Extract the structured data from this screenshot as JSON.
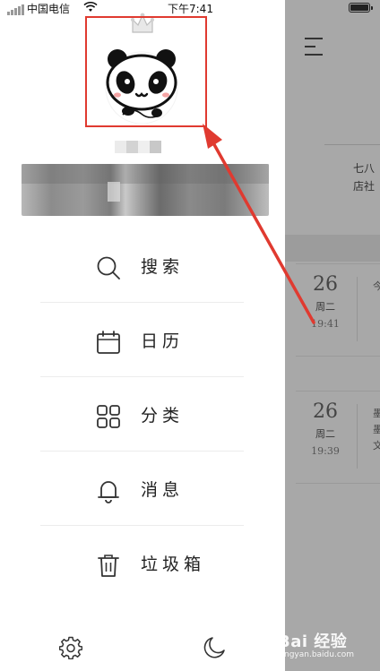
{
  "status_bar": {
    "carrier": "中国电信",
    "time": "下午7:41",
    "signal_bars": 5,
    "wifi_icon": "wifi-icon",
    "battery_icon": "battery-icon"
  },
  "drawer": {
    "avatar_icon": "panda-avatar-icon",
    "crown_icon": "crown-icon",
    "menu": [
      {
        "id": "search",
        "icon": "search-icon",
        "label": "搜索"
      },
      {
        "id": "calendar",
        "icon": "calendar-icon",
        "label": "日历"
      },
      {
        "id": "category",
        "icon": "grid-icon",
        "label": "分类"
      },
      {
        "id": "messages",
        "icon": "bell-icon",
        "label": "消息"
      },
      {
        "id": "trash",
        "icon": "trash-icon",
        "label": "垃圾箱"
      }
    ],
    "bottom_icons": [
      "gear-icon",
      "moon-icon"
    ]
  },
  "background_list": {
    "menu_icon": "hamburger-menu-icon",
    "preview_text": "七八\n店社",
    "notes": [
      {
        "day": "26",
        "weekday": "周二",
        "time": "19:41",
        "snippet": "今"
      },
      {
        "day": "26",
        "weekday": "周二",
        "time": "19:39",
        "snippet": "墨\n墨\n文"
      }
    ]
  },
  "watermark": {
    "brand": "Bai 经验",
    "url": "jingyan.baidu.com"
  },
  "colors": {
    "annotation_red": "#e03a30",
    "overlay_gray": "#a8a8a8",
    "drawer_bg": "#ffffff"
  }
}
